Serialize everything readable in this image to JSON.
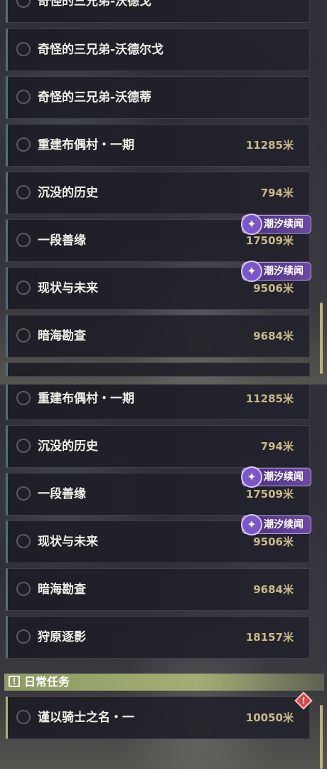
{
  "top_panel": {
    "quests": [
      {
        "title": "奇怪的三兄弟-沃德戈",
        "distance": ""
      },
      {
        "title": "奇怪的三兄弟-沃德尔戈",
        "distance": ""
      },
      {
        "title": "奇怪的三兄弟-沃德蒂",
        "distance": ""
      },
      {
        "title": "重建布偶村・一期",
        "distance": "11285米"
      },
      {
        "title": "沉没的历史",
        "distance": "794米"
      },
      {
        "title": "一段善缘",
        "distance": "17509米",
        "badge": "潮汐续闻"
      },
      {
        "title": "现状与未来",
        "distance": "9506米",
        "badge": "潮汐续闻"
      },
      {
        "title": "暗海勘查",
        "distance": "9684米"
      }
    ]
  },
  "bottom_panel": {
    "quests": [
      {
        "title": "重建布偶村・一期",
        "distance": "11285米"
      },
      {
        "title": "沉没的历史",
        "distance": "794米"
      },
      {
        "title": "一段善缘",
        "distance": "17509米",
        "badge": "潮汐续闻"
      },
      {
        "title": "现状与未来",
        "distance": "9506米",
        "badge": "潮汐续闻"
      },
      {
        "title": "暗海勘查",
        "distance": "9684米"
      },
      {
        "title": "狩原逐影",
        "distance": "18157米"
      }
    ],
    "section": {
      "title": "日常任务",
      "icon": "exclamation-icon"
    },
    "daily_quests": [
      {
        "title": "谨以骑士之名・一",
        "distance": "10050米",
        "icon": "warning-diamond-icon"
      }
    ]
  },
  "colors": {
    "accent_badge": "#6a4aa2",
    "daily_header": "#a1ae74",
    "distance_text": "#c8b98a",
    "warning": "#d44a4a"
  }
}
